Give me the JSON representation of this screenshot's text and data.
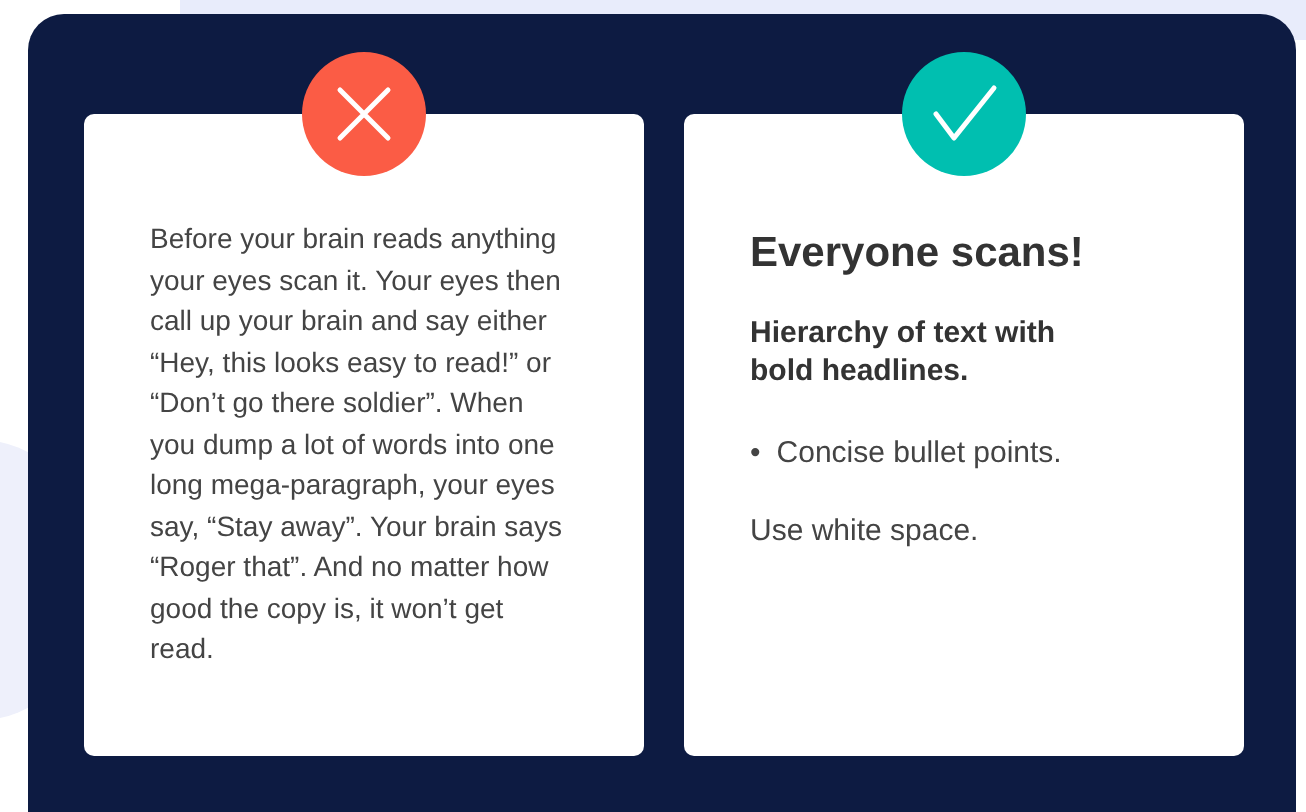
{
  "cards": [
    {
      "kind": "bad",
      "blocks": [
        {
          "kind": "paragraph",
          "text": "Before your brain reads anything your eyes scan it. Your eyes then call up your brain and say either “Hey, this looks easy to read!” or “Don’t go there soldier”. When you dump a lot of words into one long mega-paragraph, your eyes say, “Stay away”. Your brain says “Roger that”. And no matter how good the copy is, it won’t get read."
        }
      ]
    },
    {
      "kind": "good",
      "blocks": [
        {
          "kind": "heading",
          "text": "Everyone scans!"
        },
        {
          "kind": "subheading",
          "text": "Hierarchy of text with bold headlines."
        },
        {
          "kind": "bullet",
          "marker": "•",
          "text": "Concise bullet points."
        },
        {
          "kind": "text",
          "text": "Use white space."
        }
      ]
    }
  ]
}
